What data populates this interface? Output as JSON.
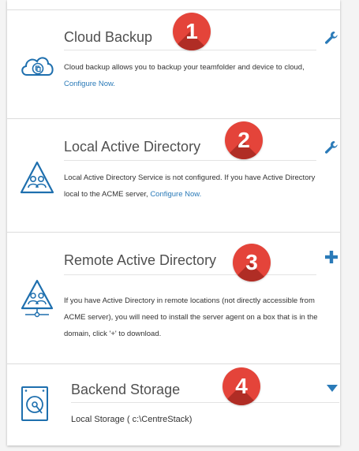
{
  "sections": [
    {
      "badge": "1",
      "title": "Cloud Backup",
      "desc": "Cloud backup allows you to backup your teamfolder and device to cloud,",
      "link": "Configure Now.",
      "action_icon": "wrench-icon"
    },
    {
      "badge": "2",
      "title": "Local Active Directory",
      "desc": "Local Active Directory Service is not configured. If you have Active Directory local to the ACME server,",
      "link": "Configure Now.",
      "action_icon": "wrench-icon"
    },
    {
      "badge": "3",
      "title": "Remote Active Directory",
      "desc": "If you have Active Directory in remote locations (not directly accessible from ACME server), you will need to install the server agent on a box that is in the domain, click '+' to download.",
      "action_icon": "plus-icon"
    },
    {
      "badge": "4",
      "title": "Backend Storage",
      "desc": "Local Storage ( c:\\CentreStack)",
      "action_icon": "caret-down-icon"
    }
  ],
  "colors": {
    "accent": "#2a7ab8",
    "badge": "#e4443a",
    "badge_shadow": "#b02d25",
    "icon_blue": "#1e6fae"
  }
}
